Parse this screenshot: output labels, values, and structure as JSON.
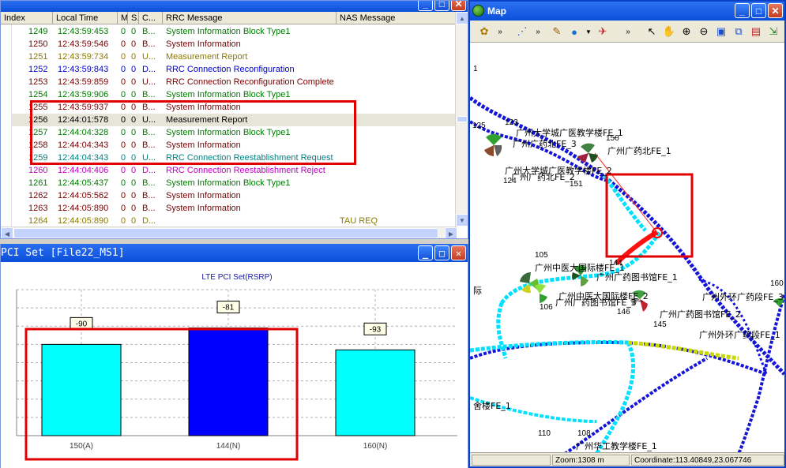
{
  "messages": {
    "columns": [
      "Index",
      "Local Time",
      "M",
      "S..",
      "C...",
      "RRC Message",
      "NAS Message"
    ],
    "rows": [
      {
        "index": "1249",
        "time": "12:43:59:453",
        "m": "0",
        "s": "0",
        "c": "B...",
        "rrc": "System Information Block Type1",
        "nas": "",
        "color": "#007a00"
      },
      {
        "index": "1250",
        "time": "12:43:59:546",
        "m": "0",
        "s": "0",
        "c": "B...",
        "rrc": "System Information",
        "nas": "",
        "color": "#7a0000"
      },
      {
        "index": "1251",
        "time": "12:43:59:734",
        "m": "0",
        "s": "0",
        "c": "U...",
        "rrc": "Measurement Report",
        "nas": "",
        "color": "#8a7a00"
      },
      {
        "index": "1252",
        "time": "12:43:59:843",
        "m": "0",
        "s": "0",
        "c": "D...",
        "rrc": "RRC Connection Reconfiguration",
        "nas": "",
        "color": "#0000c8"
      },
      {
        "index": "1253",
        "time": "12:43:59:859",
        "m": "0",
        "s": "0",
        "c": "U...",
        "rrc": "RRC Connection Reconfiguration Complete",
        "nas": "",
        "color": "#7a0000"
      },
      {
        "index": "1254",
        "time": "12:43:59:906",
        "m": "0",
        "s": "0",
        "c": "B...",
        "rrc": "System Information Block Type1",
        "nas": "",
        "color": "#007a00"
      },
      {
        "index": "1255",
        "time": "12:43:59:937",
        "m": "0",
        "s": "0",
        "c": "B...",
        "rrc": "System Information",
        "nas": "",
        "color": "#7a0000"
      },
      {
        "index": "1256",
        "time": "12:44:01:578",
        "m": "0",
        "s": "0",
        "c": "U...",
        "rrc": "Measurement Report",
        "nas": "",
        "color": "#000000",
        "selected": true
      },
      {
        "index": "1257",
        "time": "12:44:04:328",
        "m": "0",
        "s": "0",
        "c": "B...",
        "rrc": "System Information Block Type1",
        "nas": "",
        "color": "#007a00"
      },
      {
        "index": "1258",
        "time": "12:44:04:343",
        "m": "0",
        "s": "0",
        "c": "B...",
        "rrc": "System Information",
        "nas": "",
        "color": "#7a0000"
      },
      {
        "index": "1259",
        "time": "12:44:04:343",
        "m": "0",
        "s": "0",
        "c": "U...",
        "rrc": "RRC Connection Reestablishment Request",
        "nas": "",
        "color": "#008080"
      },
      {
        "index": "1260",
        "time": "12:44:04:406",
        "m": "0",
        "s": "0",
        "c": "D...",
        "rrc": "RRC Connection Reestablishment Reject",
        "nas": "",
        "color": "#c000c0"
      },
      {
        "index": "1261",
        "time": "12:44:05:437",
        "m": "0",
        "s": "0",
        "c": "B...",
        "rrc": "System Information Block Type1",
        "nas": "",
        "color": "#007a00"
      },
      {
        "index": "1262",
        "time": "12:44:05:562",
        "m": "0",
        "s": "0",
        "c": "B...",
        "rrc": "System Information",
        "nas": "",
        "color": "#7a0000"
      },
      {
        "index": "1263",
        "time": "12:44:05:890",
        "m": "0",
        "s": "0",
        "c": "B...",
        "rrc": "System Information",
        "nas": "",
        "color": "#7a0000"
      },
      {
        "index": "1264",
        "time": "12:44:05:890",
        "m": "0",
        "s": "0",
        "c": "D...",
        "rrc": "",
        "nas": "TAU REQ",
        "color": "#8a7a00"
      }
    ]
  },
  "pci_window": {
    "title": "PCI Set [File22_MS1]"
  },
  "chart_data": {
    "type": "bar",
    "title": "LTE PCI Set(RSRP)",
    "categories": [
      "150(A)",
      "144(N)",
      "160(N)"
    ],
    "values": [
      -90,
      -81,
      -93
    ],
    "labels": [
      "-90",
      "-81",
      "-93"
    ],
    "bar_colors": [
      "#00ffff",
      "#0000ff",
      "#00ffff"
    ],
    "ylim": [
      -140,
      -60
    ],
    "grid": true
  },
  "map_window": {
    "title": "Map",
    "zoom_text": "Zoom:1308 m",
    "coordinate_text": "Coordinate:113.40849,23.067746",
    "labels": [
      {
        "text": "广州大学城广医教学楼FE_1"
      },
      {
        "text": "广州广药北FE_3"
      },
      {
        "text": "广州广药北FE_1"
      },
      {
        "text": "广州大学城广医教学楼FE_2"
      },
      {
        "text": "广州广药北FE_2"
      },
      {
        "text": "广州中医大国际楼FE_1"
      },
      {
        "text": "广州广药图书馆FE_1"
      },
      {
        "text": "广州中医大国际楼FE_2"
      },
      {
        "text": "广州广药图书馆FE_3"
      },
      {
        "text": "广州广药图书馆FE_2"
      },
      {
        "text": "广州外环广药段FE_3"
      },
      {
        "text": "广州外环广药段FE_1"
      },
      {
        "text": "广州华工教学楼FE_1"
      },
      {
        "text": "舍楼FE_1"
      },
      {
        "text": "际"
      }
    ],
    "numbers": [
      "1",
      "125",
      "123",
      "150",
      "124",
      "151",
      "105",
      "144",
      "106",
      "146",
      "145",
      "160",
      "110",
      "108",
      "3"
    ]
  },
  "colors": {
    "highlight": "#e00000",
    "title_blue": "#0a4fd8"
  }
}
